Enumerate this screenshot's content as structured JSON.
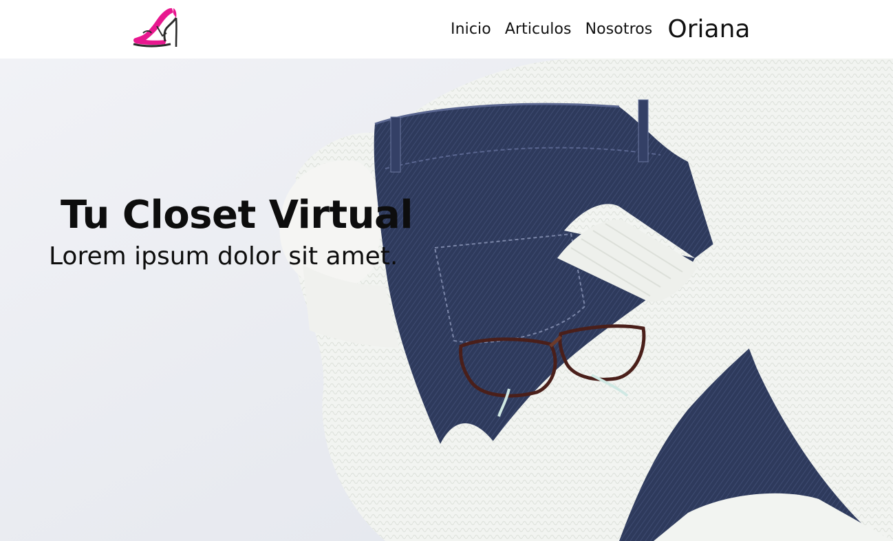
{
  "brand": {
    "logo_icon": "high-heel-shoe-logo",
    "colors": {
      "accent": "#e8178f",
      "dark": "#2b2b2b"
    }
  },
  "nav": {
    "items": [
      {
        "label": "Inicio"
      },
      {
        "label": "Articulos"
      },
      {
        "label": "Nosotros"
      }
    ],
    "user_name": "Oriana"
  },
  "hero": {
    "title": "Tu Closet Virtual",
    "subtitle": "Lorem ipsum dolor sit amet."
  }
}
